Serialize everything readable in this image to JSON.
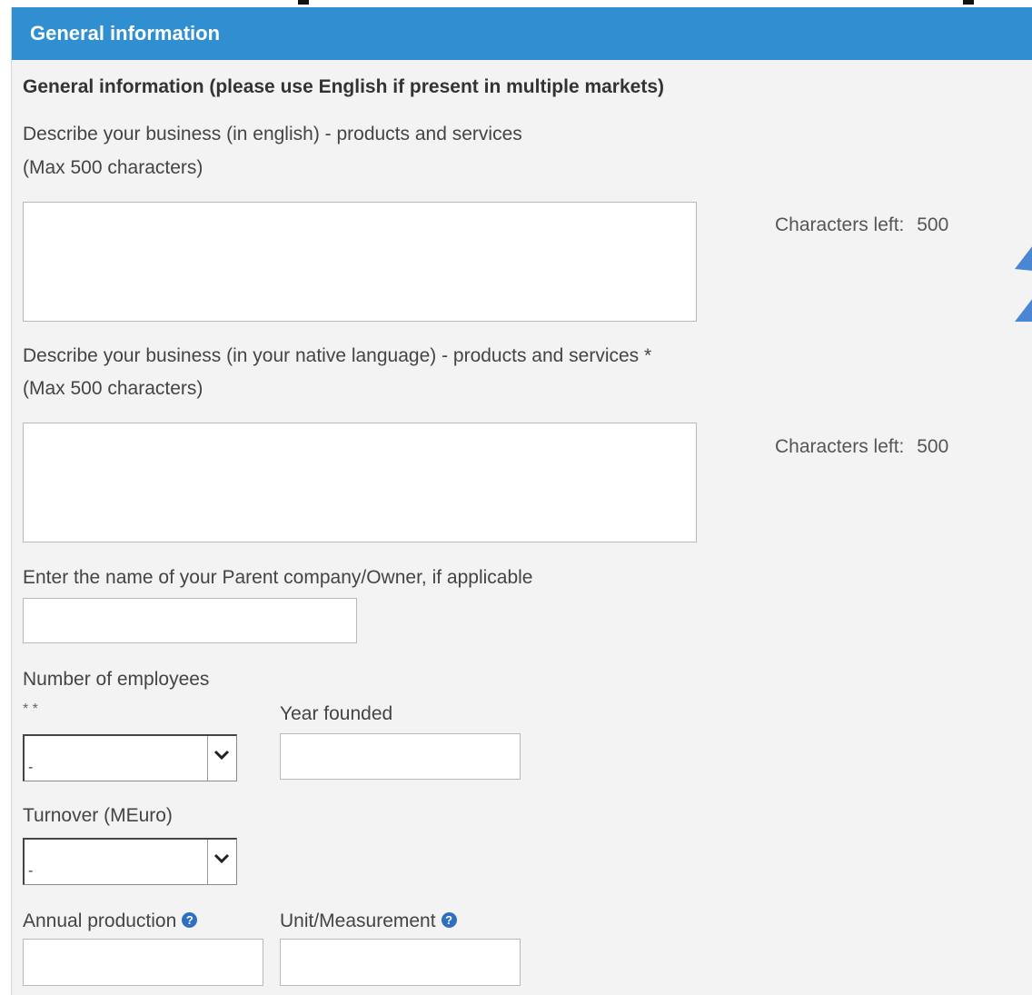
{
  "header": {
    "title": "General information"
  },
  "section": {
    "title": "General information (please use English if present in multiple markets)"
  },
  "english": {
    "label": "Describe your business (in english) - products and services",
    "max_note": "(Max 500 characters)",
    "chars_label": "Characters left:",
    "chars_value": "500",
    "value": ""
  },
  "native": {
    "label": "Describe your business (in your native language) - products and services *",
    "max_note": "(Max 500 characters)",
    "chars_label": "Characters left:",
    "chars_value": "500",
    "value": ""
  },
  "parent": {
    "label": "Enter the name of your Parent company/Owner, if applicable",
    "value": ""
  },
  "employees": {
    "label": "Number of employees",
    "required_mark": "* *",
    "selected": "-"
  },
  "year": {
    "label": "Year founded",
    "value": ""
  },
  "turnover": {
    "label": "Turnover (MEuro)",
    "selected": "-"
  },
  "production": {
    "label": "Annual production",
    "help_glyph": "?",
    "value": ""
  },
  "unit": {
    "label": "Unit/Measurement",
    "help_glyph": "?",
    "value": ""
  },
  "colors": {
    "header_bg": "#2f8fd0",
    "panel_bg": "#f3f3f3",
    "annotation_arrow": "#4a86d4"
  }
}
